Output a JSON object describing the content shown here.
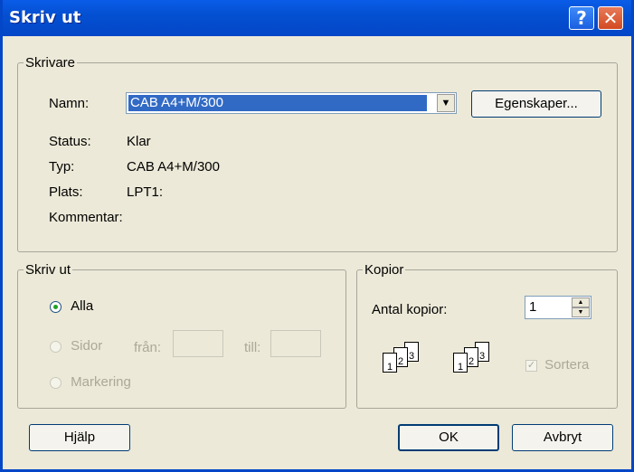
{
  "window": {
    "title": "Skriv ut"
  },
  "titlebar": {
    "help_glyph": "?",
    "close_glyph": "✕"
  },
  "printer_group": {
    "legend": "Skrivare",
    "name_label": "Namn:",
    "name_value": "CAB A4+M/300",
    "properties_button": "Egenskaper...",
    "status_label": "Status:",
    "status_value": "Klar",
    "type_label": "Typ:",
    "type_value": "CAB A4+M/300",
    "location_label": "Plats:",
    "location_value": "LPT1:",
    "comment_label": "Kommentar:",
    "comment_value": ""
  },
  "print_range": {
    "legend": "Skriv ut",
    "all_label": "Alla",
    "pages_label": "Sidor",
    "from_label": "från:",
    "to_label": "till:",
    "from_value": "",
    "to_value": "",
    "selection_label": "Markering",
    "selected": "Alla"
  },
  "copies": {
    "legend": "Kopior",
    "count_label": "Antal kopior:",
    "count_value": "1",
    "collate_label": "Sortera",
    "collate_checked": true,
    "pages_icon_labels": [
      "1",
      "2",
      "3"
    ]
  },
  "buttons": {
    "help": "Hjälp",
    "ok": "OK",
    "cancel": "Avbryt"
  }
}
